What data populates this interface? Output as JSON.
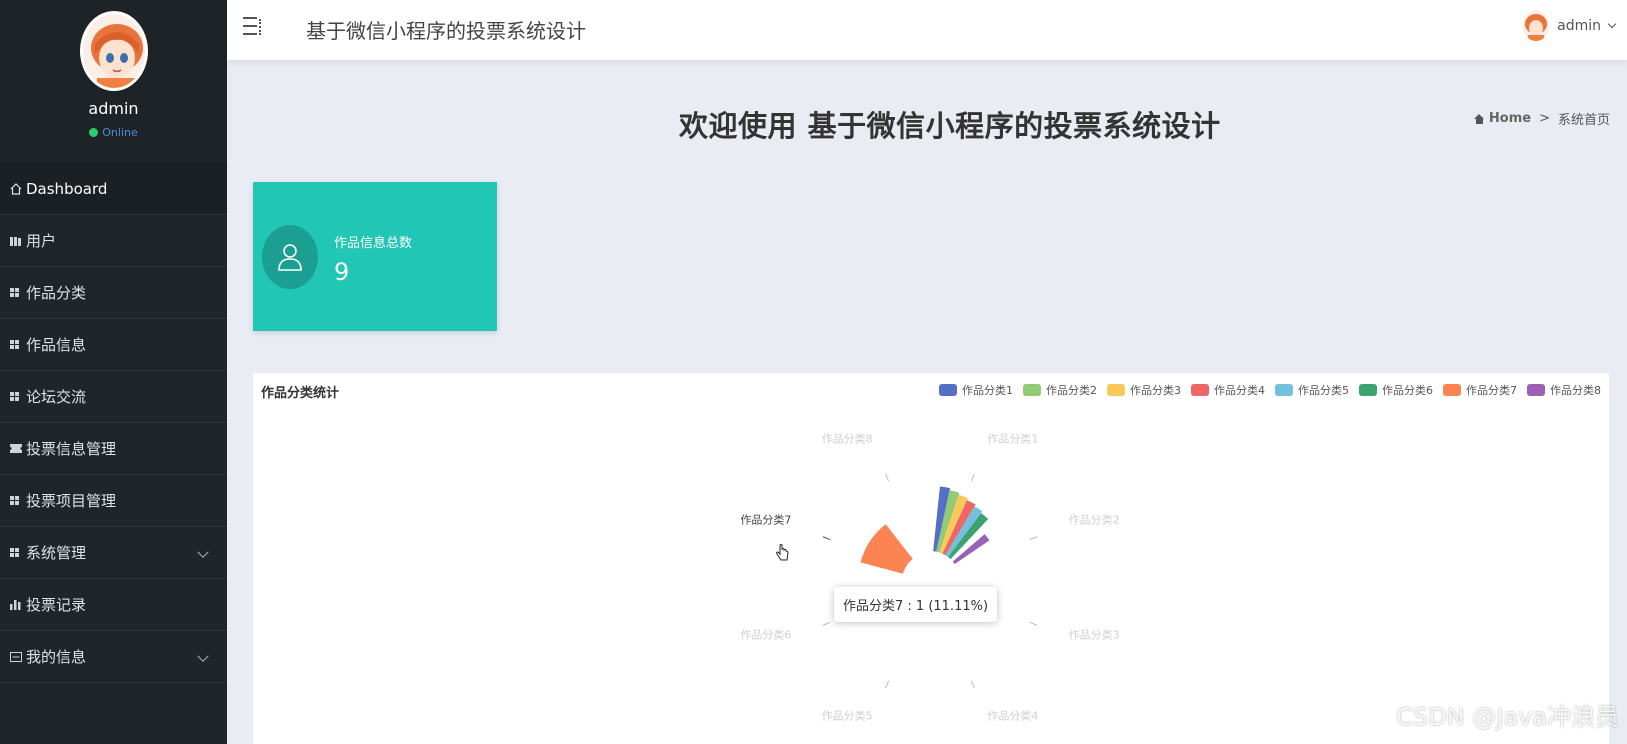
{
  "sidebar": {
    "username": "admin",
    "status": "Online",
    "items": [
      {
        "label": "Dashboard",
        "icon": "home-icon"
      },
      {
        "label": "用户",
        "icon": "book-icon"
      },
      {
        "label": "作品分类",
        "icon": "grid-icon"
      },
      {
        "label": "作品信息",
        "icon": "grid-icon"
      },
      {
        "label": "论坛交流",
        "icon": "grid-icon"
      },
      {
        "label": "投票信息管理",
        "icon": "ticket-icon"
      },
      {
        "label": "投票项目管理",
        "icon": "grid-icon"
      },
      {
        "label": "系统管理",
        "icon": "grid-icon"
      },
      {
        "label": "投票记录",
        "icon": "bar-chart-icon"
      },
      {
        "label": "我的信息",
        "icon": "card-icon"
      }
    ]
  },
  "header": {
    "title": "基于微信小程序的投票系统设计",
    "user": "admin"
  },
  "main": {
    "welcome": "欢迎使用 基于微信小程序的投票系统设计",
    "breadcrumb": {
      "home": "Home",
      "separator": ">",
      "current": "系统首页"
    },
    "stat": {
      "label": "作品信息总数",
      "value": "9"
    },
    "chart_title": "作品分类统计",
    "tooltip": "作品分类7 : 1 (11.11%)"
  },
  "colors": {
    "accent_teal": "#21c6b5",
    "sidebar_bg": "#1f2529",
    "series": [
      "#5470c6",
      "#91cc75",
      "#fac858",
      "#ee6666",
      "#73c0de",
      "#3ba272",
      "#fc8452",
      "#9a60b4"
    ]
  },
  "chart_data": {
    "type": "pie",
    "title": "作品分类统计",
    "legend_position": "top-right",
    "categories": [
      "作品分类1",
      "作品分类2",
      "作品分类3",
      "作品分类4",
      "作品分类5",
      "作品分类6",
      "作品分类7",
      "作品分类8"
    ],
    "values": [
      1,
      1,
      1,
      1,
      1,
      1,
      1,
      1
    ],
    "highlighted": "作品分类7",
    "highlighted_percent": 11.11
  },
  "watermark": "CSDN @Java冲浪员"
}
